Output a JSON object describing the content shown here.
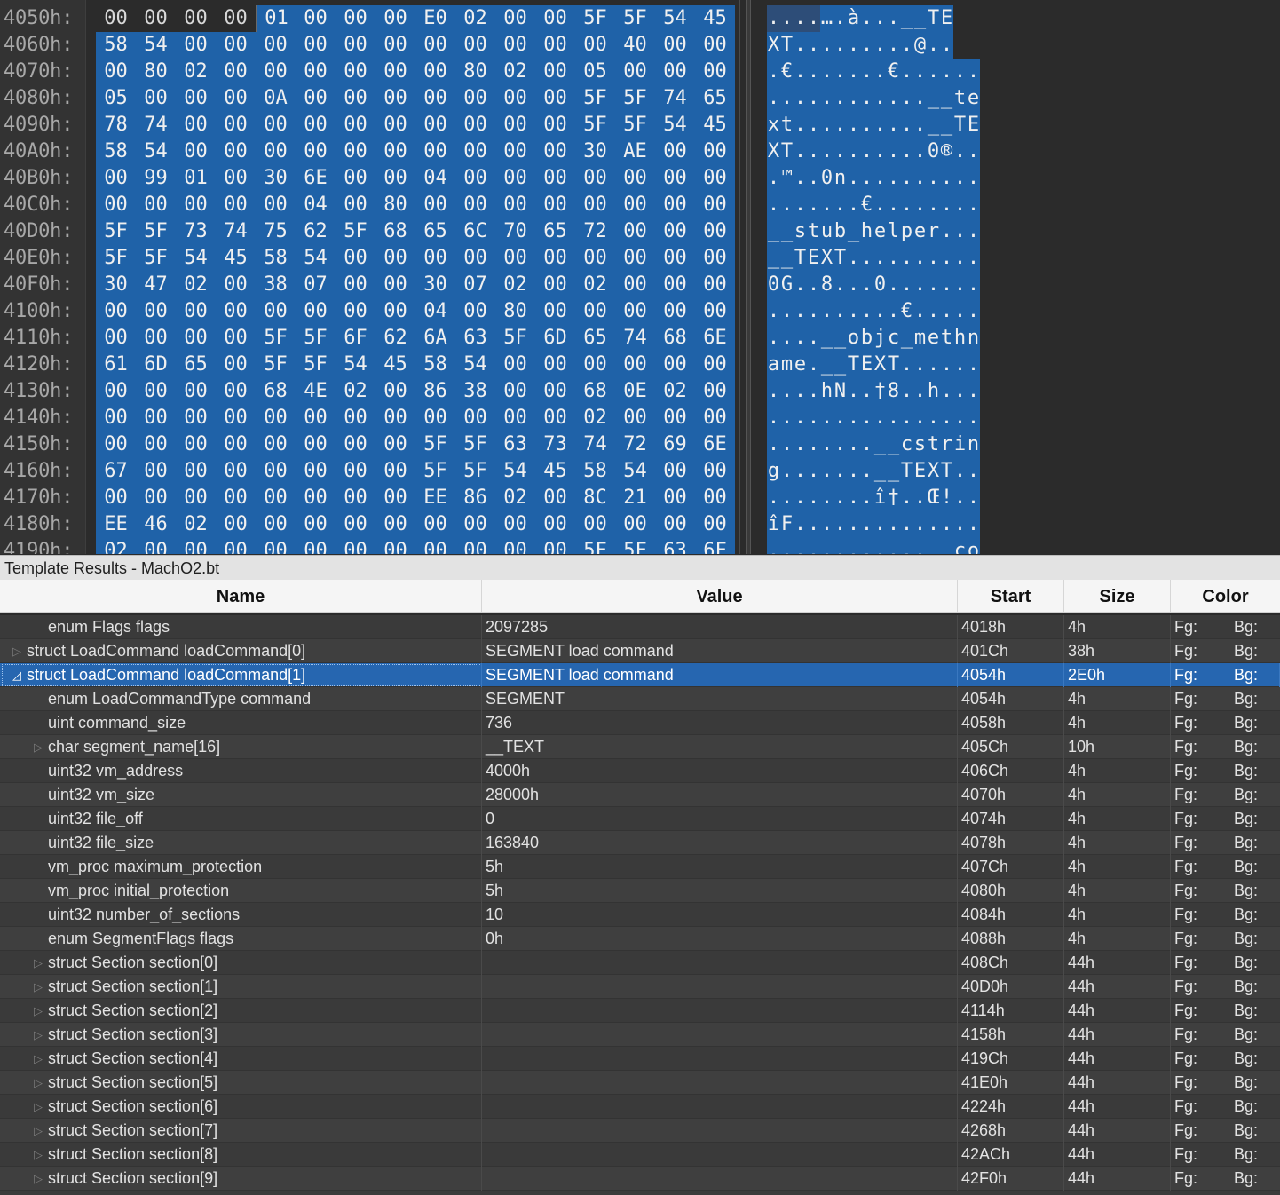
{
  "hex_view": {
    "rows": [
      {
        "addr": "4050h:",
        "bytes": [
          "00",
          "00",
          "00",
          "00",
          "01",
          "00",
          "00",
          "00",
          "E0",
          "02",
          "00",
          "00",
          "5F",
          "5F",
          "54",
          "45"
        ],
        "ascii": "....….à...__TE"
      },
      {
        "addr": "4060h:",
        "bytes": [
          "58",
          "54",
          "00",
          "00",
          "00",
          "00",
          "00",
          "00",
          "00",
          "00",
          "00",
          "00",
          "00",
          "40",
          "00",
          "00"
        ],
        "ascii": "XT.........@.."
      },
      {
        "addr": "4070h:",
        "bytes": [
          "00",
          "80",
          "02",
          "00",
          "00",
          "00",
          "00",
          "00",
          "00",
          "80",
          "02",
          "00",
          "05",
          "00",
          "00",
          "00"
        ],
        "ascii": ".€.......€......"
      },
      {
        "addr": "4080h:",
        "bytes": [
          "05",
          "00",
          "00",
          "00",
          "0A",
          "00",
          "00",
          "00",
          "00",
          "00",
          "00",
          "00",
          "5F",
          "5F",
          "74",
          "65"
        ],
        "ascii": "............__te"
      },
      {
        "addr": "4090h:",
        "bytes": [
          "78",
          "74",
          "00",
          "00",
          "00",
          "00",
          "00",
          "00",
          "00",
          "00",
          "00",
          "00",
          "5F",
          "5F",
          "54",
          "45"
        ],
        "ascii": "xt..........__TE"
      },
      {
        "addr": "40A0h:",
        "bytes": [
          "58",
          "54",
          "00",
          "00",
          "00",
          "00",
          "00",
          "00",
          "00",
          "00",
          "00",
          "00",
          "30",
          "AE",
          "00",
          "00"
        ],
        "ascii": "XT..........0®.."
      },
      {
        "addr": "40B0h:",
        "bytes": [
          "00",
          "99",
          "01",
          "00",
          "30",
          "6E",
          "00",
          "00",
          "04",
          "00",
          "00",
          "00",
          "00",
          "00",
          "00",
          "00"
        ],
        "ascii": ".™..0n.........."
      },
      {
        "addr": "40C0h:",
        "bytes": [
          "00",
          "00",
          "00",
          "00",
          "00",
          "04",
          "00",
          "80",
          "00",
          "00",
          "00",
          "00",
          "00",
          "00",
          "00",
          "00"
        ],
        "ascii": ".......€........"
      },
      {
        "addr": "40D0h:",
        "bytes": [
          "5F",
          "5F",
          "73",
          "74",
          "75",
          "62",
          "5F",
          "68",
          "65",
          "6C",
          "70",
          "65",
          "72",
          "00",
          "00",
          "00"
        ],
        "ascii": "__stub_helper..."
      },
      {
        "addr": "40E0h:",
        "bytes": [
          "5F",
          "5F",
          "54",
          "45",
          "58",
          "54",
          "00",
          "00",
          "00",
          "00",
          "00",
          "00",
          "00",
          "00",
          "00",
          "00"
        ],
        "ascii": "__TEXT.........."
      },
      {
        "addr": "40F0h:",
        "bytes": [
          "30",
          "47",
          "02",
          "00",
          "38",
          "07",
          "00",
          "00",
          "30",
          "07",
          "02",
          "00",
          "02",
          "00",
          "00",
          "00"
        ],
        "ascii": "0G..8...0......."
      },
      {
        "addr": "4100h:",
        "bytes": [
          "00",
          "00",
          "00",
          "00",
          "00",
          "00",
          "00",
          "00",
          "04",
          "00",
          "80",
          "00",
          "00",
          "00",
          "00",
          "00"
        ],
        "ascii": "..........€....."
      },
      {
        "addr": "4110h:",
        "bytes": [
          "00",
          "00",
          "00",
          "00",
          "5F",
          "5F",
          "6F",
          "62",
          "6A",
          "63",
          "5F",
          "6D",
          "65",
          "74",
          "68",
          "6E"
        ],
        "ascii": "....__objc_methn"
      },
      {
        "addr": "4120h:",
        "bytes": [
          "61",
          "6D",
          "65",
          "00",
          "5F",
          "5F",
          "54",
          "45",
          "58",
          "54",
          "00",
          "00",
          "00",
          "00",
          "00",
          "00"
        ],
        "ascii": "ame.__TEXT......"
      },
      {
        "addr": "4130h:",
        "bytes": [
          "00",
          "00",
          "00",
          "00",
          "68",
          "4E",
          "02",
          "00",
          "86",
          "38",
          "00",
          "00",
          "68",
          "0E",
          "02",
          "00"
        ],
        "ascii": "....hN..†8..h..."
      },
      {
        "addr": "4140h:",
        "bytes": [
          "00",
          "00",
          "00",
          "00",
          "00",
          "00",
          "00",
          "00",
          "00",
          "00",
          "00",
          "00",
          "02",
          "00",
          "00",
          "00"
        ],
        "ascii": "................"
      },
      {
        "addr": "4150h:",
        "bytes": [
          "00",
          "00",
          "00",
          "00",
          "00",
          "00",
          "00",
          "00",
          "5F",
          "5F",
          "63",
          "73",
          "74",
          "72",
          "69",
          "6E"
        ],
        "ascii": "........__cstrin"
      },
      {
        "addr": "4160h:",
        "bytes": [
          "67",
          "00",
          "00",
          "00",
          "00",
          "00",
          "00",
          "00",
          "5F",
          "5F",
          "54",
          "45",
          "58",
          "54",
          "00",
          "00"
        ],
        "ascii": "g.......__TEXT.."
      },
      {
        "addr": "4170h:",
        "bytes": [
          "00",
          "00",
          "00",
          "00",
          "00",
          "00",
          "00",
          "00",
          "EE",
          "86",
          "02",
          "00",
          "8C",
          "21",
          "00",
          "00"
        ],
        "ascii": "........î†..Œ!.."
      },
      {
        "addr": "4180h:",
        "bytes": [
          "EE",
          "46",
          "02",
          "00",
          "00",
          "00",
          "00",
          "00",
          "00",
          "00",
          "00",
          "00",
          "00",
          "00",
          "00",
          "00"
        ],
        "ascii": "îF.............."
      },
      {
        "addr": "4190h:",
        "bytes": [
          "02",
          "00",
          "00",
          "00",
          "00",
          "00",
          "00",
          "00",
          "00",
          "00",
          "00",
          "00",
          "5F",
          "5F",
          "63",
          "6F"
        ],
        "ascii": "............__co"
      }
    ]
  },
  "template_results": {
    "title": "Template Results - MachO2.bt",
    "columns": {
      "name": "Name",
      "value": "Value",
      "start": "Start",
      "size": "Size",
      "color": "Color"
    },
    "rows": [
      {
        "name": "enum Flags flags",
        "value": "2097285",
        "start": "4018h",
        "size": "4h",
        "fg": "Fg:",
        "bg": "Bg:",
        "indent": 1,
        "expander": ""
      },
      {
        "name": "struct LoadCommand loadCommand[0]",
        "value": "SEGMENT load command",
        "start": "401Ch",
        "size": "38h",
        "fg": "Fg:",
        "bg": "Bg:",
        "indent": 0,
        "expander": "collapsed"
      },
      {
        "name": "struct LoadCommand loadCommand[1]",
        "value": "SEGMENT load command",
        "start": "4054h",
        "size": "2E0h",
        "fg": "Fg:",
        "bg": "Bg:",
        "indent": 0,
        "expander": "expanded",
        "selected": true
      },
      {
        "name": "enum LoadCommandType command",
        "value": "SEGMENT",
        "start": "4054h",
        "size": "4h",
        "fg": "Fg:",
        "bg": "Bg:",
        "indent": 1,
        "expander": ""
      },
      {
        "name": "uint command_size",
        "value": "736",
        "start": "4058h",
        "size": "4h",
        "fg": "Fg:",
        "bg": "Bg:",
        "indent": 1,
        "expander": ""
      },
      {
        "name": "char segment_name[16]",
        "value": "__TEXT",
        "start": "405Ch",
        "size": "10h",
        "fg": "Fg:",
        "bg": "Bg:",
        "indent": 1,
        "expander": "collapsed"
      },
      {
        "name": "uint32 vm_address",
        "value": "4000h",
        "start": "406Ch",
        "size": "4h",
        "fg": "Fg:",
        "bg": "Bg:",
        "indent": 1,
        "expander": ""
      },
      {
        "name": "uint32 vm_size",
        "value": "28000h",
        "start": "4070h",
        "size": "4h",
        "fg": "Fg:",
        "bg": "Bg:",
        "indent": 1,
        "expander": ""
      },
      {
        "name": "uint32 file_off",
        "value": "0",
        "start": "4074h",
        "size": "4h",
        "fg": "Fg:",
        "bg": "Bg:",
        "indent": 1,
        "expander": ""
      },
      {
        "name": "uint32 file_size",
        "value": "163840",
        "start": "4078h",
        "size": "4h",
        "fg": "Fg:",
        "bg": "Bg:",
        "indent": 1,
        "expander": ""
      },
      {
        "name": "vm_proc maximum_protection",
        "value": "5h",
        "start": "407Ch",
        "size": "4h",
        "fg": "Fg:",
        "bg": "Bg:",
        "indent": 1,
        "expander": ""
      },
      {
        "name": "vm_proc initial_protection",
        "value": "5h",
        "start": "4080h",
        "size": "4h",
        "fg": "Fg:",
        "bg": "Bg:",
        "indent": 1,
        "expander": ""
      },
      {
        "name": "uint32 number_of_sections",
        "value": "10",
        "start": "4084h",
        "size": "4h",
        "fg": "Fg:",
        "bg": "Bg:",
        "indent": 1,
        "expander": ""
      },
      {
        "name": "enum SegmentFlags flags",
        "value": "0h",
        "start": "4088h",
        "size": "4h",
        "fg": "Fg:",
        "bg": "Bg:",
        "indent": 1,
        "expander": ""
      },
      {
        "name": "struct Section section[0]",
        "value": "",
        "start": "408Ch",
        "size": "44h",
        "fg": "Fg:",
        "bg": "Bg:",
        "indent": 1,
        "expander": "collapsed"
      },
      {
        "name": "struct Section section[1]",
        "value": "",
        "start": "40D0h",
        "size": "44h",
        "fg": "Fg:",
        "bg": "Bg:",
        "indent": 1,
        "expander": "collapsed"
      },
      {
        "name": "struct Section section[2]",
        "value": "",
        "start": "4114h",
        "size": "44h",
        "fg": "Fg:",
        "bg": "Bg:",
        "indent": 1,
        "expander": "collapsed"
      },
      {
        "name": "struct Section section[3]",
        "value": "",
        "start": "4158h",
        "size": "44h",
        "fg": "Fg:",
        "bg": "Bg:",
        "indent": 1,
        "expander": "collapsed"
      },
      {
        "name": "struct Section section[4]",
        "value": "",
        "start": "419Ch",
        "size": "44h",
        "fg": "Fg:",
        "bg": "Bg:",
        "indent": 1,
        "expander": "collapsed"
      },
      {
        "name": "struct Section section[5]",
        "value": "",
        "start": "41E0h",
        "size": "44h",
        "fg": "Fg:",
        "bg": "Bg:",
        "indent": 1,
        "expander": "collapsed"
      },
      {
        "name": "struct Section section[6]",
        "value": "",
        "start": "4224h",
        "size": "44h",
        "fg": "Fg:",
        "bg": "Bg:",
        "indent": 1,
        "expander": "collapsed"
      },
      {
        "name": "struct Section section[7]",
        "value": "",
        "start": "4268h",
        "size": "44h",
        "fg": "Fg:",
        "bg": "Bg:",
        "indent": 1,
        "expander": "collapsed"
      },
      {
        "name": "struct Section section[8]",
        "value": "",
        "start": "42ACh",
        "size": "44h",
        "fg": "Fg:",
        "bg": "Bg:",
        "indent": 1,
        "expander": "collapsed"
      },
      {
        "name": "struct Section section[9]",
        "value": "",
        "start": "42F0h",
        "size": "44h",
        "fg": "Fg:",
        "bg": "Bg:",
        "indent": 1,
        "expander": "collapsed"
      }
    ]
  },
  "colors": {
    "selection": "#1f62a8",
    "row_selected": "#2666b0",
    "background": "#2b2b2b"
  }
}
